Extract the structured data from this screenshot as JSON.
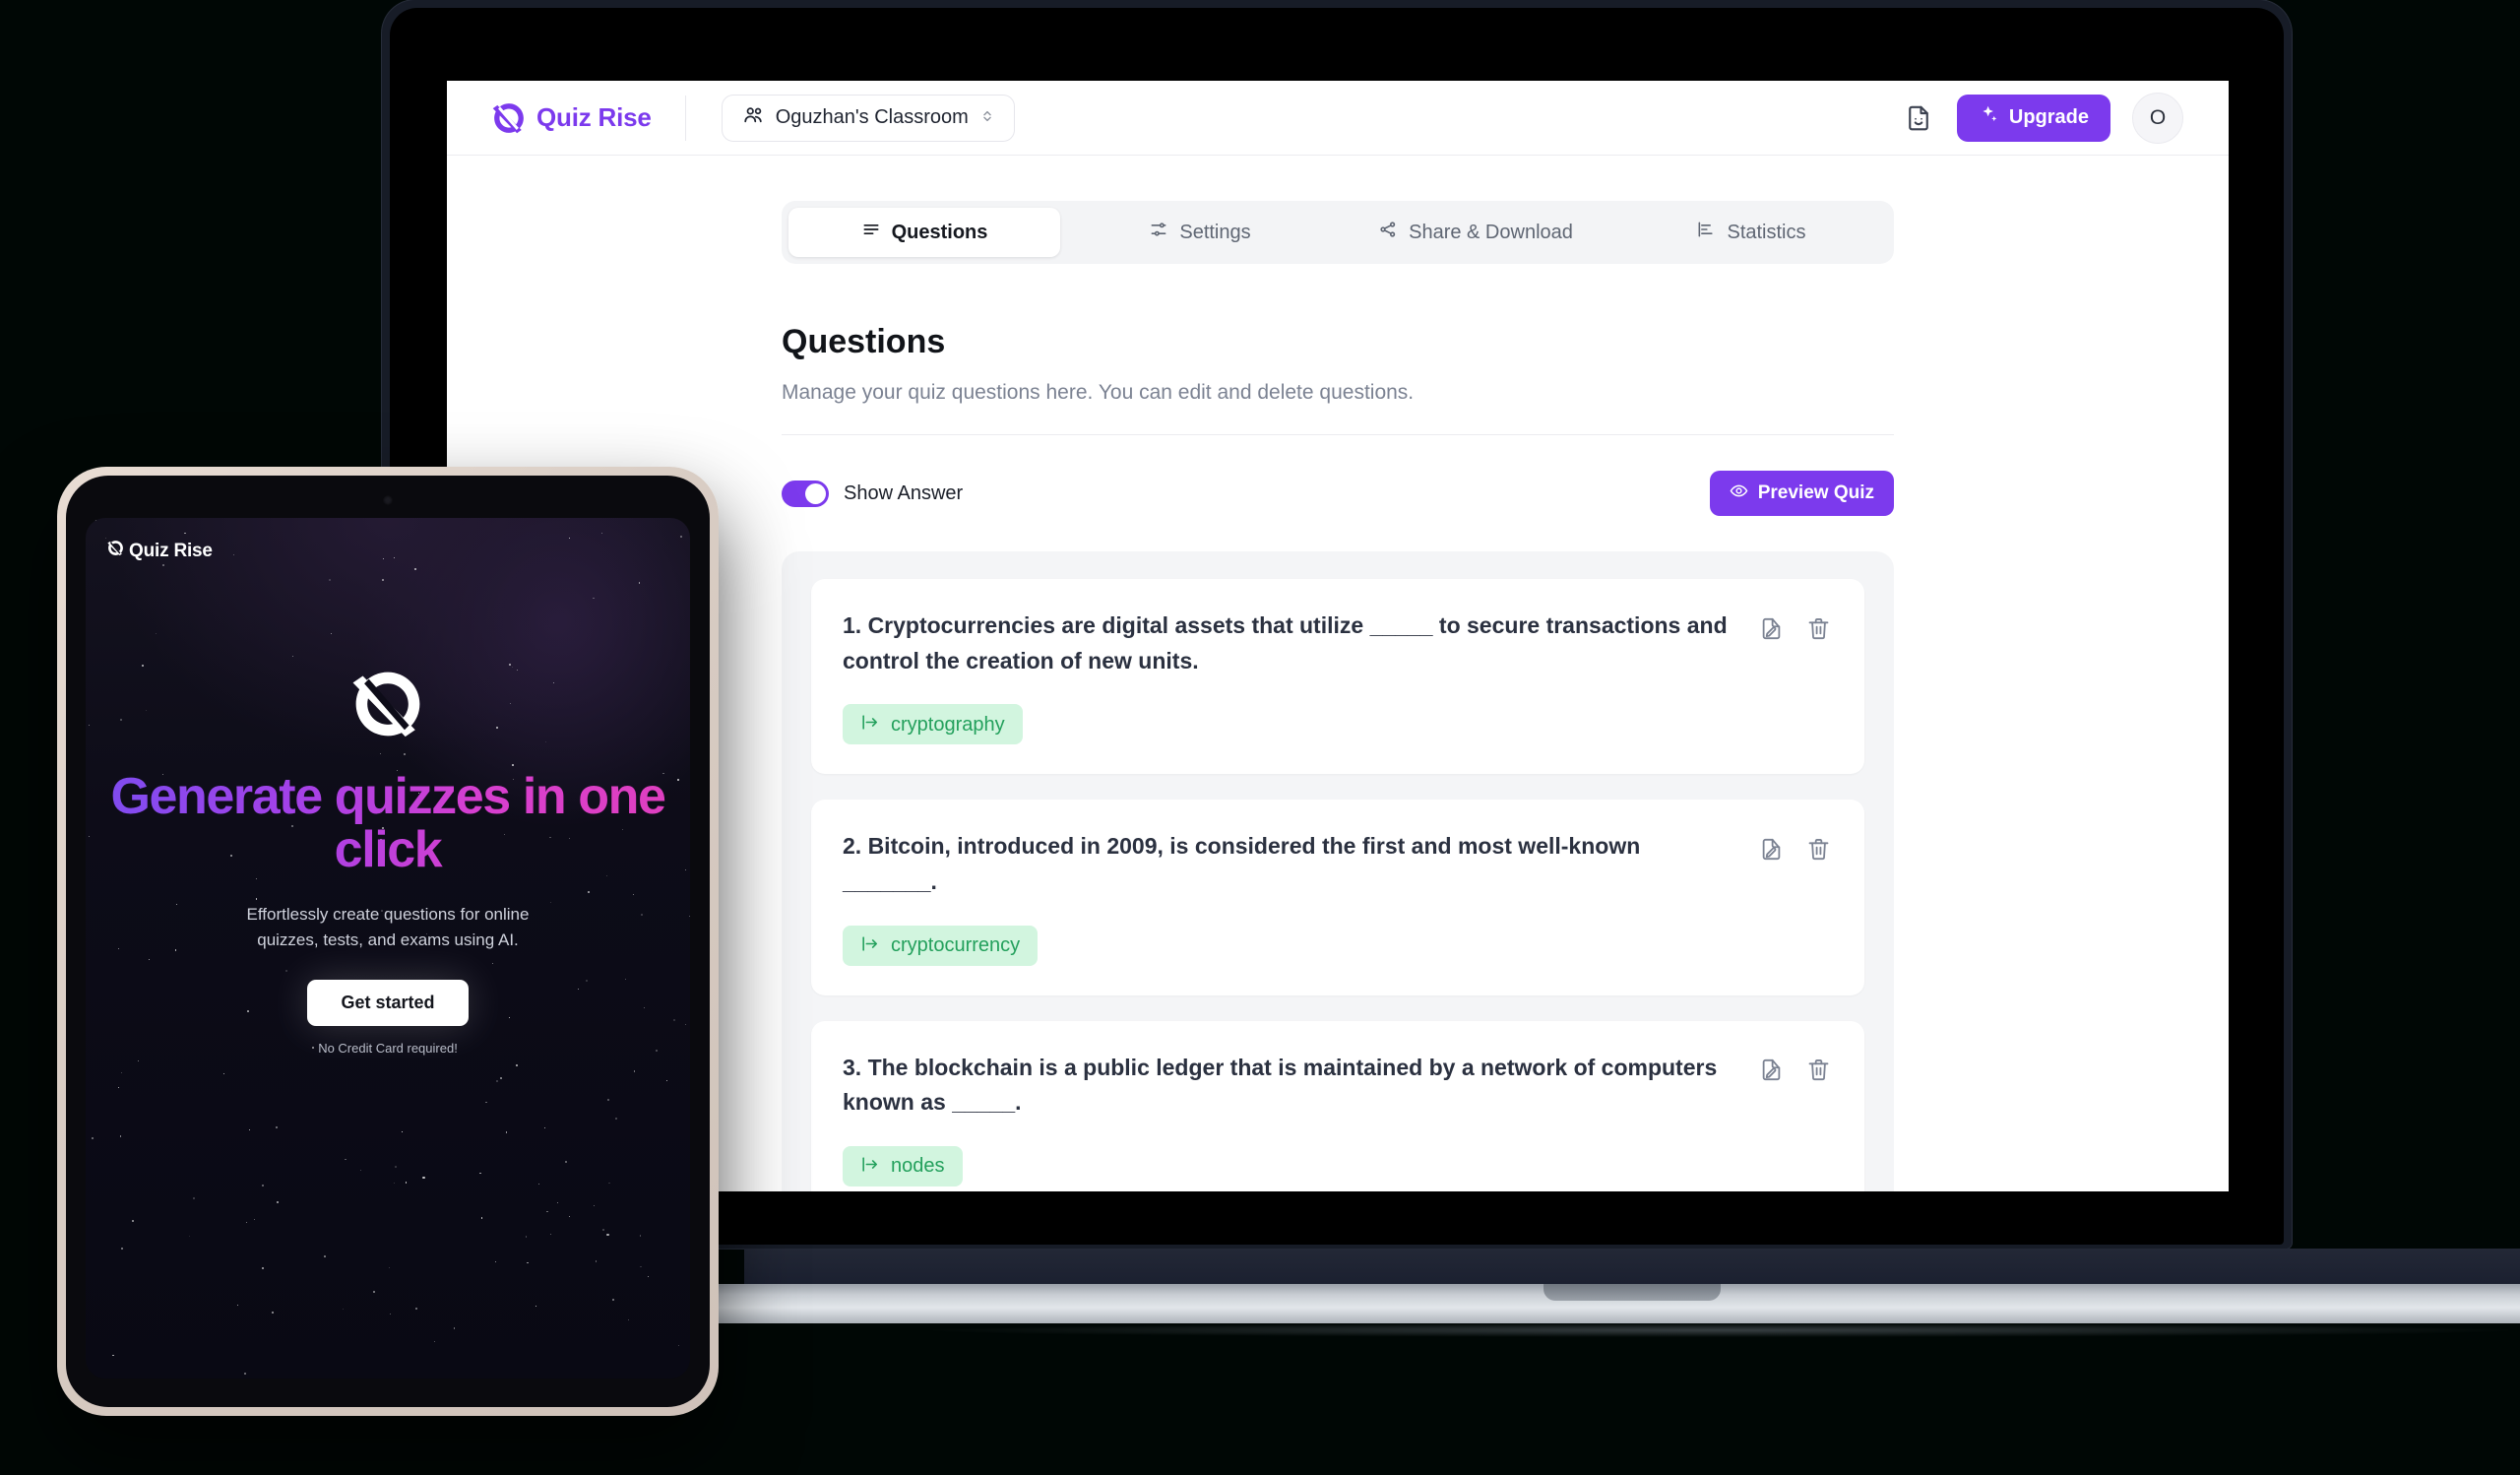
{
  "theme": {
    "accent": "#7c3aed",
    "page_background": "#000705",
    "chip_background": "#d2f5df",
    "chip_text": "#23a05c",
    "panel_background": "#f4f5f7"
  },
  "laptop": {
    "topbar": {
      "brand_name": "Quiz Rise",
      "brand_logo_icon": "quizrise-logo-icon",
      "classroom_selector": {
        "icon": "users-icon",
        "label": "Oguzhan's Classroom",
        "chevron": "⌃⌄"
      },
      "document_icon": "document-smiley-icon",
      "upgrade_button": {
        "label": "Upgrade",
        "icon": "sparkles-icon"
      },
      "avatar_initial": "O"
    },
    "tabs": [
      {
        "label": "Questions",
        "icon": "list-icon",
        "active": true
      },
      {
        "label": "Settings",
        "icon": "sliders-icon",
        "active": false
      },
      {
        "label": "Share & Download",
        "icon": "share-icon",
        "active": false
      },
      {
        "label": "Statistics",
        "icon": "bar-chart-icon",
        "active": false
      }
    ],
    "page": {
      "title": "Questions",
      "subtitle": "Manage your quiz questions here. You can edit and delete questions."
    },
    "toolbar": {
      "show_answer_label": "Show Answer",
      "show_answer_on": true,
      "preview_button": {
        "label": "Preview Quiz",
        "icon": "eye-icon"
      }
    },
    "questions": [
      {
        "number": "1.",
        "text": "1. Cryptocurrencies are digital assets that utilize _____ to secure transactions and control the creation of new units.",
        "answer": "cryptography",
        "answer_icon": "arrow-to-right-icon",
        "edit_icon": "edit-document-icon",
        "delete_icon": "trash-icon"
      },
      {
        "number": "2.",
        "text": "2. Bitcoin, introduced in 2009, is considered the first and most well-known _______.",
        "answer": "cryptocurrency",
        "answer_icon": "arrow-to-right-icon",
        "edit_icon": "edit-document-icon",
        "delete_icon": "trash-icon"
      },
      {
        "number": "3.",
        "text": "3. The blockchain is a public ledger that is maintained by a network of computers known as _____.",
        "answer": "nodes",
        "answer_icon": "arrow-to-right-icon",
        "edit_icon": "edit-document-icon",
        "delete_icon": "trash-icon"
      }
    ]
  },
  "tablet": {
    "brand_name": "Quiz Rise",
    "brand_logo_icon": "quizrise-logo-icon",
    "hero_logo_icon": "quizrise-logo-mark-icon",
    "headline": "Generate quizzes in one click",
    "subheadline": "Effortlessly create questions for online quizzes, tests, and exams using AI.",
    "cta_label": "Get started",
    "cta_note": "No Credit Card required!"
  }
}
